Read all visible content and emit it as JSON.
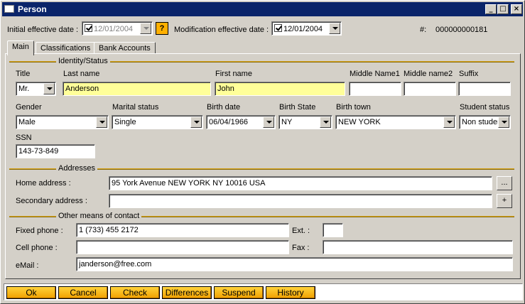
{
  "window": {
    "title": "Person",
    "minimize": "_",
    "maximize": "□",
    "close": "×"
  },
  "header": {
    "initial_label": "Initial effective date :",
    "initial_value": "12/01/2004",
    "help_label": "?",
    "mod_label": "Modification effective date :",
    "mod_value": "12/01/2004",
    "id_label": "#:",
    "id_value": "000000000181"
  },
  "tabs": [
    "Main",
    "Classifications",
    "Bank Accounts"
  ],
  "identity": {
    "section_title": "Identity/Status",
    "title_label": "Title",
    "title_value": "Mr.",
    "last_label": "Last name",
    "last_value": "Anderson",
    "first_label": "First name",
    "first_value": "John",
    "middle1_label": "Middle Name1",
    "middle1_value": "",
    "middle2_label": "Middle name2",
    "middle2_value": "",
    "suffix_label": "Suffix",
    "suffix_value": "",
    "gender_label": "Gender",
    "gender_value": "Male",
    "marital_label": "Marital status",
    "marital_value": "Single",
    "birthdate_label": "Birth date",
    "birthdate_value": "06/04/1966",
    "birthstate_label": "Birth State",
    "birthstate_value": "NY",
    "birthtown_label": "Birth town",
    "birthtown_value": "NEW YORK",
    "student_label": "Student status",
    "student_value": "Non student",
    "ssn_label": "SSN",
    "ssn_value": "143-73-849"
  },
  "addresses": {
    "section_title": "Addresses",
    "home_label": "Home address :",
    "home_value": "95 York Avenue  NEW YORK NY 10016 USA",
    "home_btn": "...",
    "secondary_label": "Secondary address :",
    "secondary_value": "",
    "secondary_btn": "+"
  },
  "contact": {
    "section_title": "Other means of contact",
    "fixed_label": "Fixed phone :",
    "fixed_value": "1 (733) 455 2172",
    "ext_label": "Ext. :",
    "ext_value": "",
    "cell_label": "Cell phone :",
    "cell_value": "",
    "fax_label": "Fax :",
    "fax_value": "",
    "email_label": "eMail :",
    "email_value": "janderson@free.com"
  },
  "actions": [
    "Ok",
    "Cancel",
    "Check",
    "Differences",
    "Suspend",
    "History"
  ],
  "colors": {
    "title_bar": "#0a246a",
    "required_field": "#ffff99",
    "action_button": "#f0a000",
    "section_rule": "#d4a017"
  }
}
